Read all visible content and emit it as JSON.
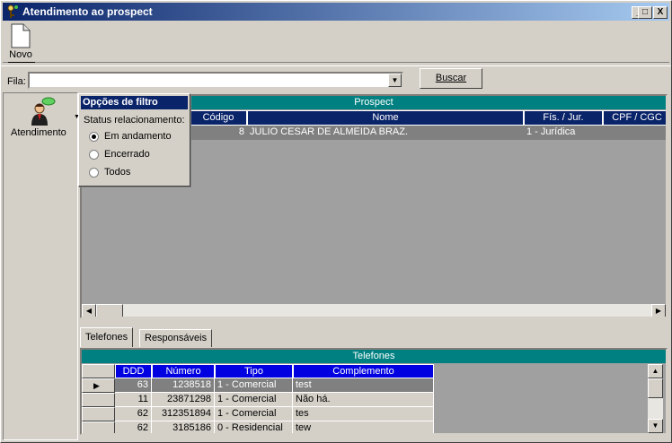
{
  "window": {
    "title": "Atendimento ao prospect",
    "minimize": "_",
    "maximize": "□",
    "close": "X"
  },
  "toolbar": {
    "novo_label": "Novo"
  },
  "fila": {
    "label": "Fila:",
    "value": "",
    "search_label": "Buscar"
  },
  "left": {
    "atendimento_label": "Atendimento"
  },
  "filter_popup": {
    "title": "Opções de filtro",
    "status_label": "Status relacionamento:",
    "options": [
      {
        "label": "Em andamento",
        "selected": true
      },
      {
        "label": "Encerrado",
        "selected": false
      },
      {
        "label": "Todos",
        "selected": false
      }
    ]
  },
  "prospect_grid": {
    "title": "Prospect",
    "columns": [
      "Código",
      "Nome",
      "Fís. / Jur.",
      "CPF / CGC"
    ],
    "rows": [
      {
        "codigo": "8",
        "nome": "JULIO CESAR DE ALMEIDA BRAZ.",
        "fis_jur": "1 - Jurídica",
        "cpf": ""
      }
    ]
  },
  "tabs": [
    {
      "label": "Telefones",
      "active": true
    },
    {
      "label": "Responsáveis",
      "active": false
    }
  ],
  "telefones": {
    "title": "Telefones",
    "columns": [
      "DDD",
      "Número",
      "Tipo",
      "Complemento"
    ],
    "rows": [
      {
        "ddd": "63",
        "numero": "1238518",
        "tipo": "1 - Comercial",
        "complemento": "test"
      },
      {
        "ddd": "11",
        "numero": "23871298",
        "tipo": "1 - Comercial",
        "complemento": "Não há."
      },
      {
        "ddd": "62",
        "numero": "312351894",
        "tipo": "1 - Comercial",
        "complemento": "tes"
      },
      {
        "ddd": "62",
        "numero": "3185186",
        "tipo": "0 - Residencial",
        "complemento": "tew"
      }
    ]
  },
  "icons": {
    "app": "key-person-icon",
    "novo": "new-document-icon",
    "atendimento": "agent-chat-icon"
  }
}
